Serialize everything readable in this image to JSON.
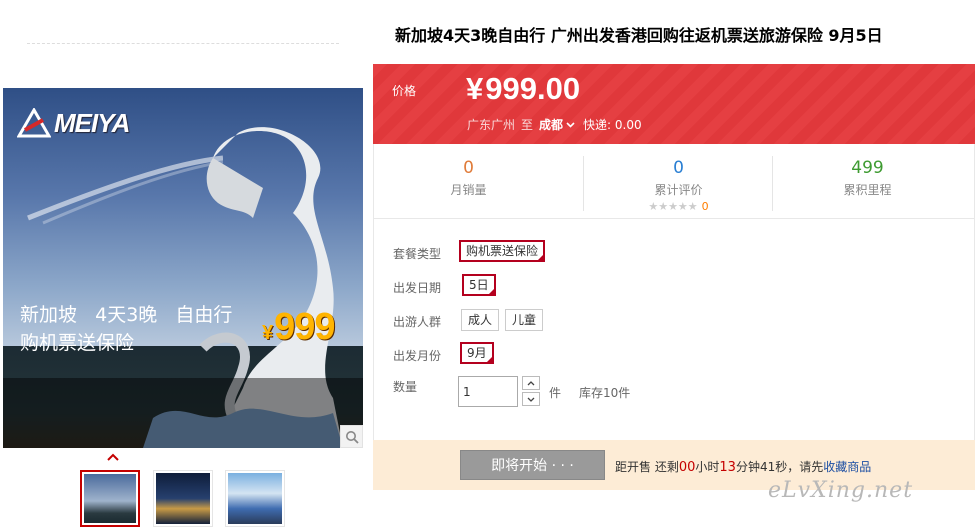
{
  "gallery": {
    "brand_logo_text": "MEIYA",
    "banner_line1": "新加坡   4天3晚   自由行",
    "banner_line2": "购机票送保险",
    "banner_price_currency": "¥",
    "banner_price": "999"
  },
  "product": {
    "title": "新加坡4天3晚自由行 广州出发香港回购往返机票送旅游保险 9月5日",
    "price_label": "价格",
    "price_currency": "¥",
    "price": "999.00",
    "ship_from": "广东广州",
    "ship_to_word": "至",
    "ship_dest": "成都",
    "ship_fee": "快递: 0.00"
  },
  "stats": [
    {
      "value": "0",
      "label": "月销量",
      "color": "#e07b39"
    },
    {
      "value": "0",
      "label": "累计评价",
      "color": "#2a7fd3",
      "stars": "★★★★★",
      "rating_count": "0"
    },
    {
      "value": "499",
      "label": "累积里程",
      "color": "#3e9b31"
    }
  ],
  "options": {
    "package_label": "套餐类型",
    "package_value": "购机票送保险",
    "date_label": "出发日期",
    "date_value": "5日",
    "group_label": "出游人群",
    "group_adult": "成人",
    "group_child": "儿童",
    "month_label": "出发月份",
    "month_value": "9月",
    "qty_label": "数量",
    "qty_value": "1",
    "qty_unit": "件",
    "stock": "库存10件"
  },
  "buy": {
    "button_label": "即将开始 · · ·",
    "countdown_prefix": "距开售 还剩",
    "days": "00",
    "hours_word": "小时",
    "minutes": "13",
    "minutes_word": "分钟",
    "seconds_text": "41秒，请先",
    "fav_link": "收藏商品"
  },
  "watermark": "eLvXing.net",
  "colors": {
    "accent": "#e4393c",
    "selected_border": "#b4001e",
    "buy_bar": "#fdecd6"
  }
}
